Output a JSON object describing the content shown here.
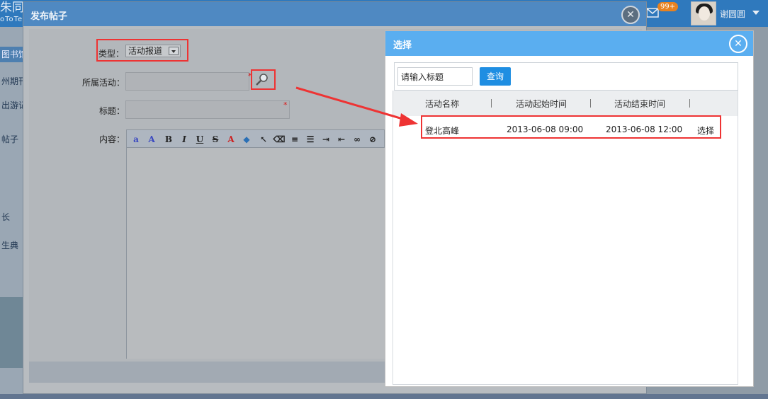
{
  "app": {
    "logo_text": "朱同",
    "logo_sub": "oToTe",
    "mail_badge": "99+",
    "username": "谢圆圆"
  },
  "sidebar": {
    "items": [
      {
        "label": "图书馆"
      },
      {
        "label": "州期刊"
      },
      {
        "label": "出游记"
      },
      {
        "label": "帖子"
      },
      {
        "label": "长"
      },
      {
        "label": "生典"
      }
    ]
  },
  "dialog": {
    "title": "发布帖子",
    "type_label": "类型：",
    "type_value": "活动报道",
    "activity_label": "所属活动：",
    "activity_required": "*",
    "title_label": "标题：",
    "title_required": "*",
    "content_label": "内容："
  },
  "editor_toolbar": [
    {
      "icon": "font-family-icon",
      "glyph": "a"
    },
    {
      "icon": "font-size-icon",
      "glyph": "A"
    },
    {
      "icon": "bold-icon",
      "glyph": "B"
    },
    {
      "icon": "italic-icon",
      "glyph": "I"
    },
    {
      "icon": "underline-icon",
      "glyph": "U"
    },
    {
      "icon": "strikethrough-icon",
      "glyph": "S"
    },
    {
      "icon": "font-color-icon",
      "glyph": "A"
    },
    {
      "icon": "highlight-icon",
      "glyph": "◆"
    },
    {
      "icon": "select-pointer-icon",
      "glyph": "↖"
    },
    {
      "icon": "eraser-icon",
      "glyph": "⌫"
    },
    {
      "icon": "align-icon",
      "glyph": "≡"
    },
    {
      "icon": "list-icon",
      "glyph": "☰"
    },
    {
      "icon": "indent-icon",
      "glyph": "⇥"
    },
    {
      "icon": "outdent-icon",
      "glyph": "⇤"
    },
    {
      "icon": "link-icon",
      "glyph": "∞"
    },
    {
      "icon": "unlink-icon",
      "glyph": "⊘"
    }
  ],
  "panel": {
    "title": "选择",
    "search_placeholder": "请输入标题",
    "search_button": "查询",
    "columns": [
      "活动名称",
      "活动起始时间",
      "活动结束时间"
    ],
    "rows": [
      {
        "name": "登北高峰",
        "start": "2013-06-08 09:00",
        "end": "2013-06-08 12:00",
        "action": "选择"
      }
    ]
  },
  "colors": {
    "panel_header": "#5aaef0",
    "search_button": "#1f8ee2",
    "highlight_box": "#ee3333",
    "dialog_header": "#4f89c2"
  }
}
